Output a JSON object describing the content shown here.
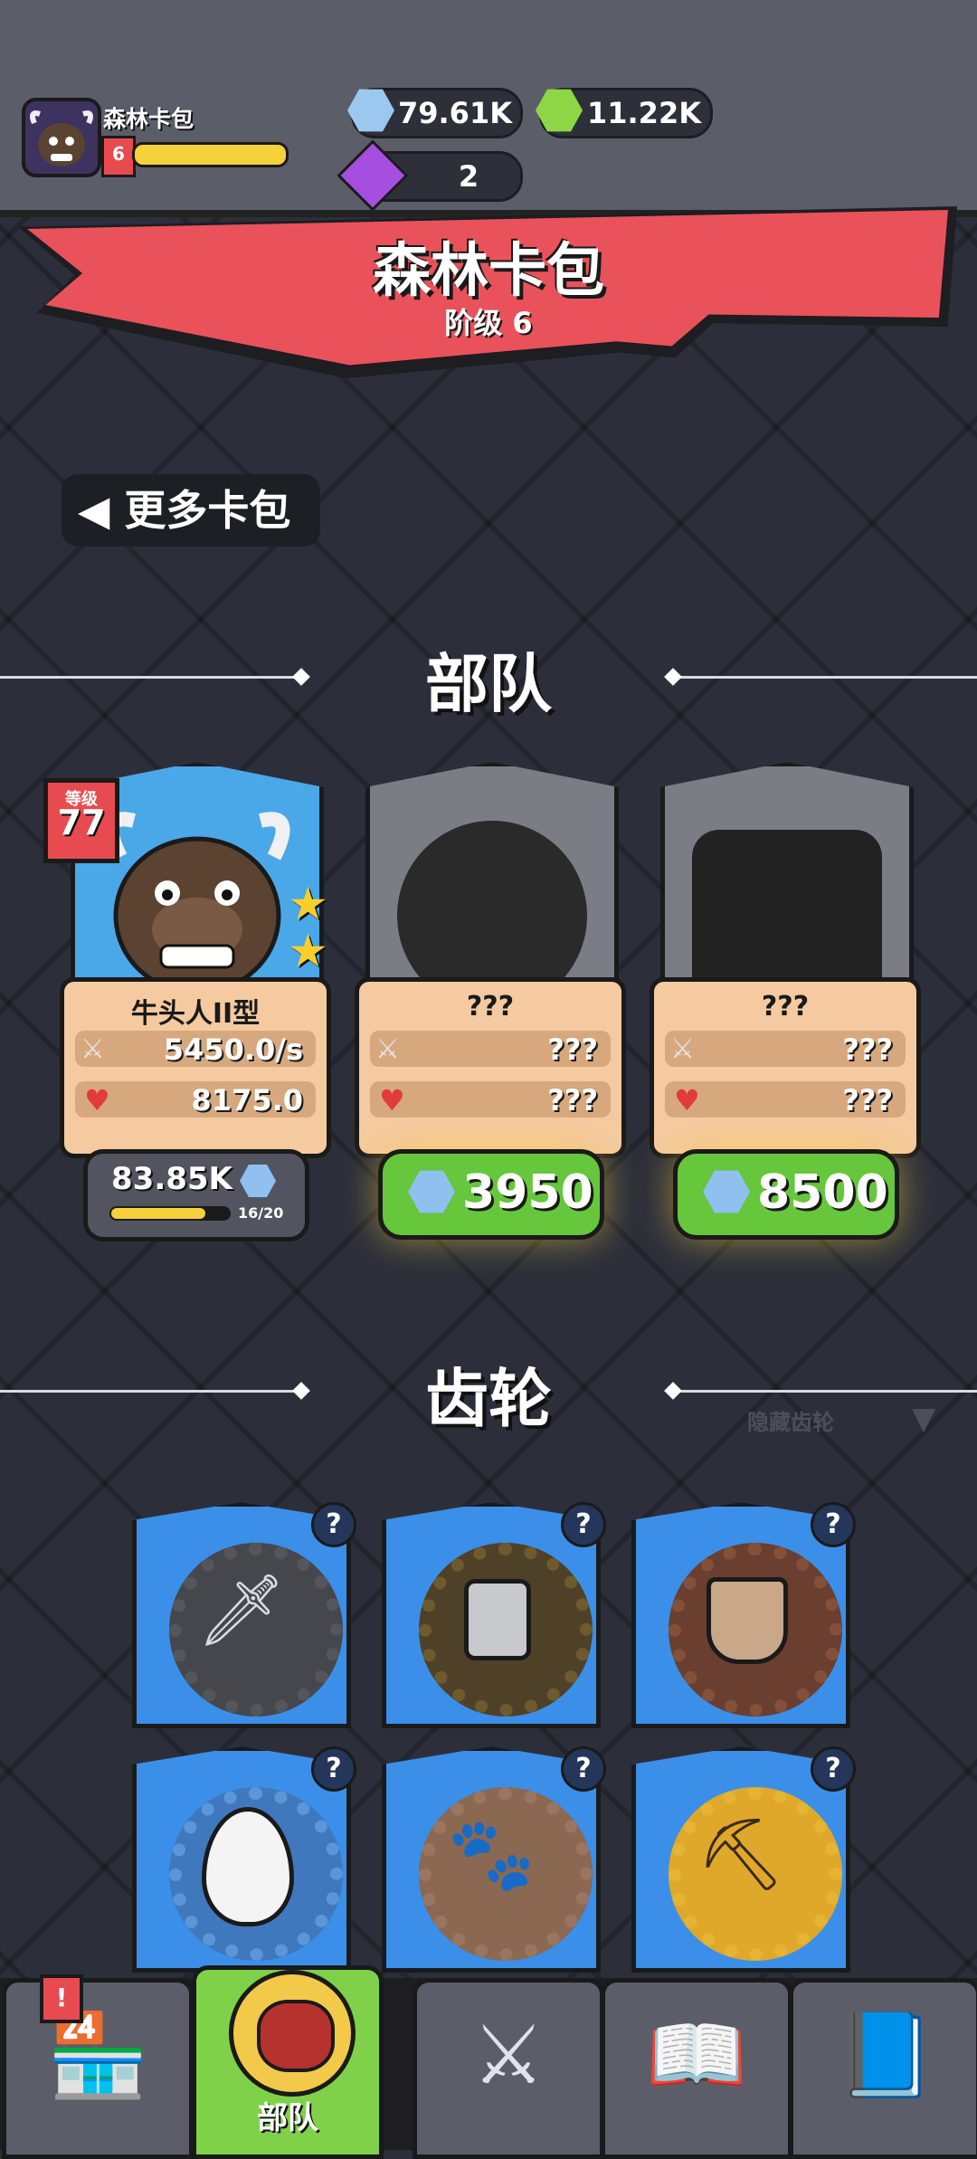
{
  "player": {
    "name": "森林卡包",
    "level": "6",
    "xp_fraction": 0.95
  },
  "currency": {
    "gears": "79.61K",
    "green": "11.22K",
    "gems": "2"
  },
  "banner": {
    "title": "森林卡包",
    "tier": "阶级 6"
  },
  "more_packs_label": "更多卡包",
  "troops_section": {
    "title": "部队",
    "cards": [
      {
        "level_label": "等级",
        "level": "77",
        "name": "牛头人II型",
        "attack": "5450.0/s",
        "health": "8175.0",
        "stars": 2,
        "cost": "83.85K",
        "progress": "16/20",
        "progress_fraction": 0.8
      },
      {
        "name": "???",
        "attack": "???",
        "health": "???",
        "price": "3950"
      },
      {
        "name": "???",
        "attack": "???",
        "health": "???",
        "price": "8500"
      }
    ]
  },
  "gears_section": {
    "title": "齿轮",
    "hide_label": "隐藏齿轮",
    "badge": "?",
    "items": [
      "kunai-icon",
      "barrel-icon",
      "vase-icon",
      "egg-icon",
      "paw-icon",
      "pickaxe-icon"
    ]
  },
  "nav": {
    "alert_badge": "!",
    "troops_label": "部队",
    "tabs": [
      "shop-icon",
      "troops-icon",
      "battle-icon",
      "book-icon",
      "gear-book-icon"
    ]
  },
  "colors": {
    "accent_red": "#e9525a",
    "button_green": "#66c63c",
    "tile_blue": "#3b8fe8"
  }
}
